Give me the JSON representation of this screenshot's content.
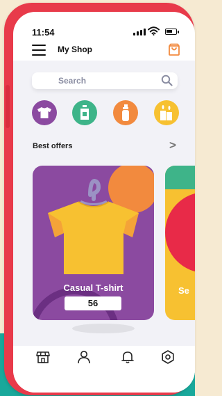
{
  "status_bar": {
    "time": "11:54"
  },
  "header": {
    "title": "My Shop",
    "menu_icon": "hamburger-menu-icon",
    "cart_icon": "shopping-bag-icon"
  },
  "search": {
    "placeholder": "Search",
    "icon": "search-icon"
  },
  "categories": [
    {
      "name": "t-shirt-category",
      "icon": "t-shirt-icon",
      "color": "#8b4aa0"
    },
    {
      "name": "bottle-category",
      "icon": "bottle-icon",
      "color": "#3eb489"
    },
    {
      "name": "spray-category",
      "icon": "spray-bottle-icon",
      "color": "#f28a3e"
    },
    {
      "name": "candles-category",
      "icon": "candles-icon",
      "color": "#f7c131"
    }
  ],
  "best_offers": {
    "title": "Best offers",
    "arrow": ">"
  },
  "offers": [
    {
      "title": "Casual T-shirt",
      "price": "56",
      "color": "#8b4aa0"
    },
    {
      "title": "Se",
      "color": "#f7c131"
    }
  ],
  "bottom_nav": [
    {
      "name": "store-icon"
    },
    {
      "name": "profile-icon"
    },
    {
      "name": "bell-icon"
    },
    {
      "name": "settings-icon"
    }
  ],
  "colors": {
    "phone_frame": "#e83a4a",
    "background_teal": "#19a89b",
    "background_cream": "#f6ead2",
    "tshirt": "#f7c131",
    "accent_orange": "#f28a3e",
    "accent_red": "#e82a48",
    "accent_green": "#3eb489"
  }
}
